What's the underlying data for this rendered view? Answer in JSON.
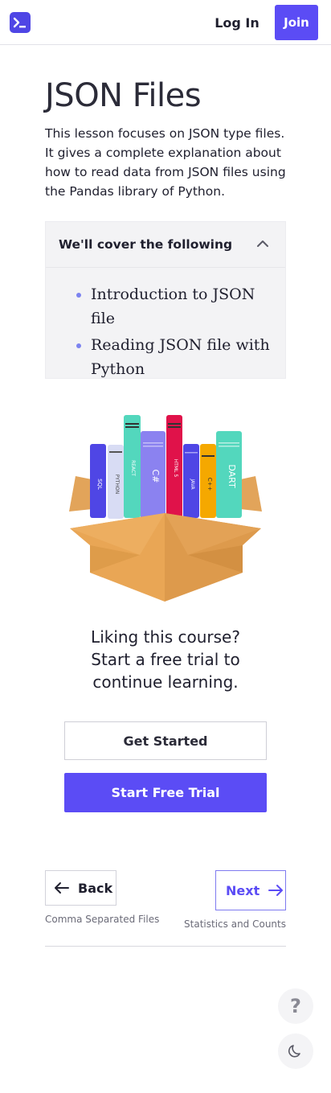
{
  "header": {
    "login_label": "Log In",
    "join_label": "Join"
  },
  "lesson": {
    "title": "JSON Files",
    "description": "This lesson focuses on JSON type files. It gives a complete explanation about how to read data from JSON files using the Pandas library of Python."
  },
  "cover": {
    "heading": "We'll cover the following",
    "items": [
      {
        "label": "Introduction to JSON file"
      },
      {
        "label": "Reading JSON file with Python"
      }
    ]
  },
  "illustration": {
    "book_labels": [
      "SQL",
      "PYTHON",
      "REACT",
      "C#",
      "HTML 5",
      "JAVA",
      "C++",
      "DART"
    ]
  },
  "cta": {
    "prompt": "Liking this course? Start a free trial to continue learning.",
    "get_started_label": "Get Started",
    "free_trial_label": "Start Free Trial"
  },
  "pager": {
    "back_label": "Back",
    "back_sub": "Comma Separated Files",
    "next_label": "Next",
    "next_sub": "Statistics and Counts"
  },
  "fabs": {
    "help_glyph": "?",
    "help_icon": "question-icon",
    "theme_icon": "moon-icon"
  },
  "colors": {
    "accent": "#5b4cf5",
    "logo": "#4f46e5",
    "bullet": "#7c83f0",
    "box": "#e9a655"
  }
}
